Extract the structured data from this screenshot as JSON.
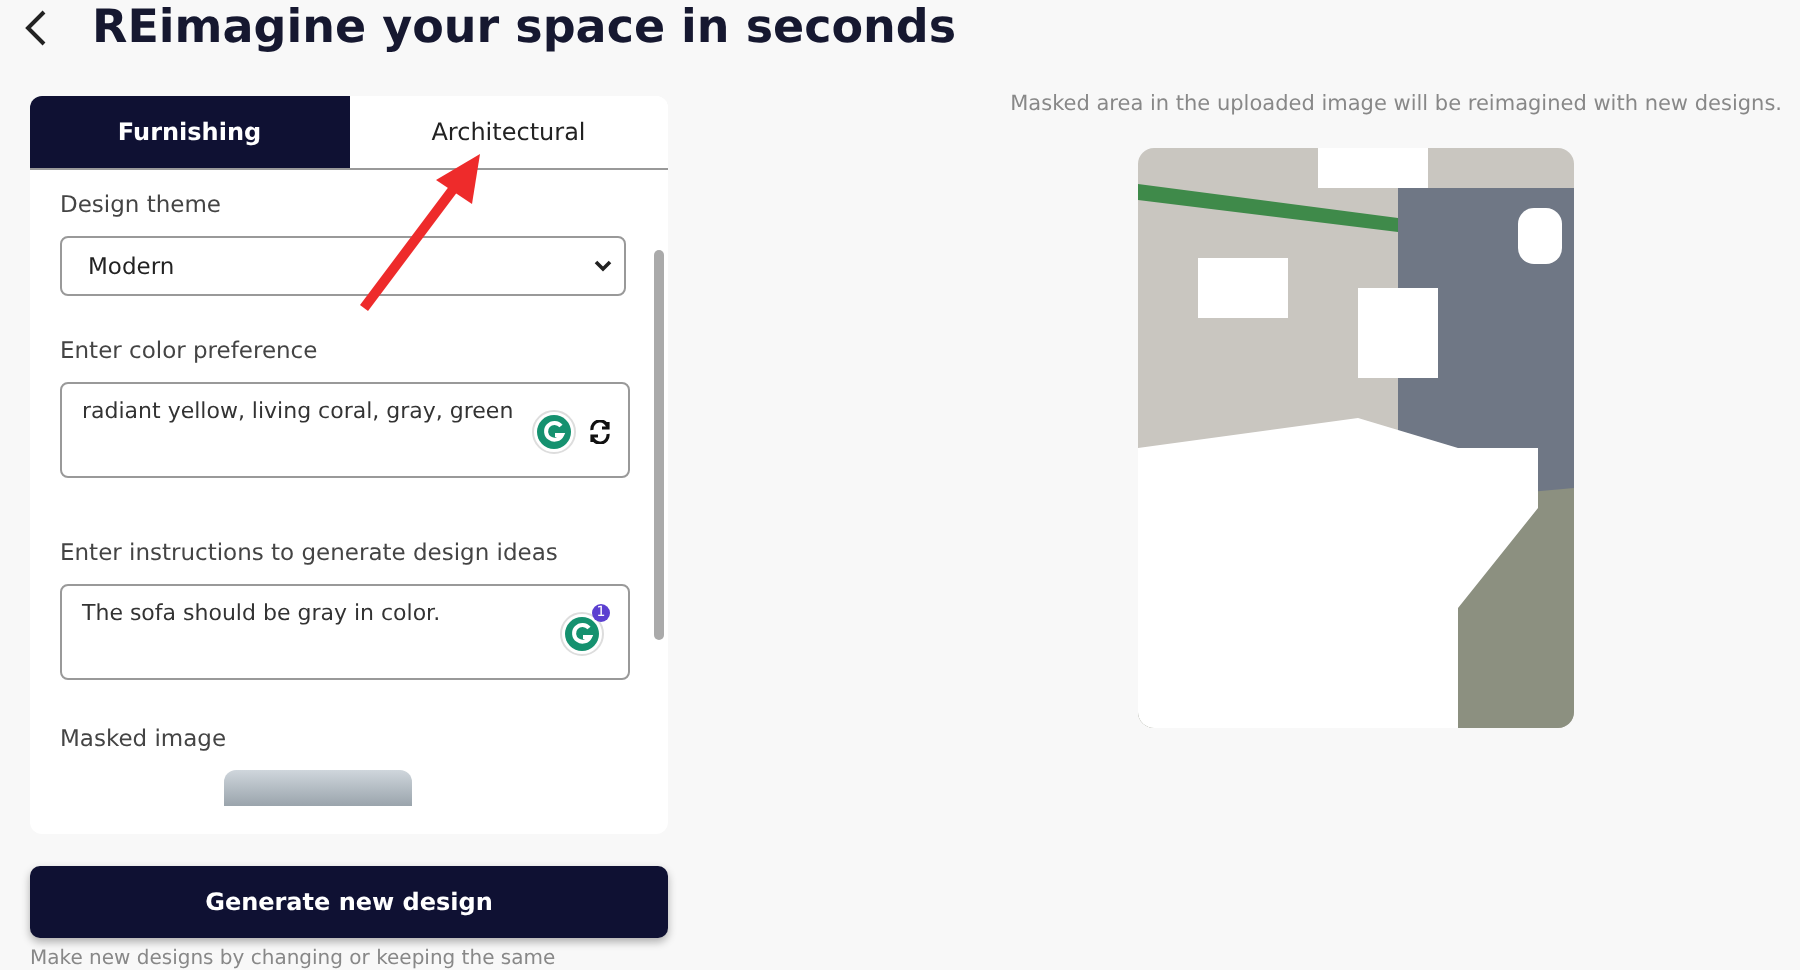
{
  "header": {
    "title": "REimagine your space in seconds"
  },
  "tabs": [
    {
      "label": "Furnishing",
      "selected": true
    },
    {
      "label": "Architectural",
      "selected": false
    }
  ],
  "form": {
    "theme_label": "Design theme",
    "theme_value": "Modern",
    "color_label": "Enter color preference",
    "color_value": "radiant yellow, living coral, gray, green",
    "instructions_label": "Enter instructions to generate design ideas",
    "instructions_value": "The sofa should be gray in color.",
    "instructions_badge": "1",
    "masked_label": "Masked image"
  },
  "generate_button": "Generate new design",
  "footnote": "Make new designs by changing or keeping the same",
  "preview": {
    "caption": "Masked area in the uploaded image will be reimagined with new designs."
  }
}
